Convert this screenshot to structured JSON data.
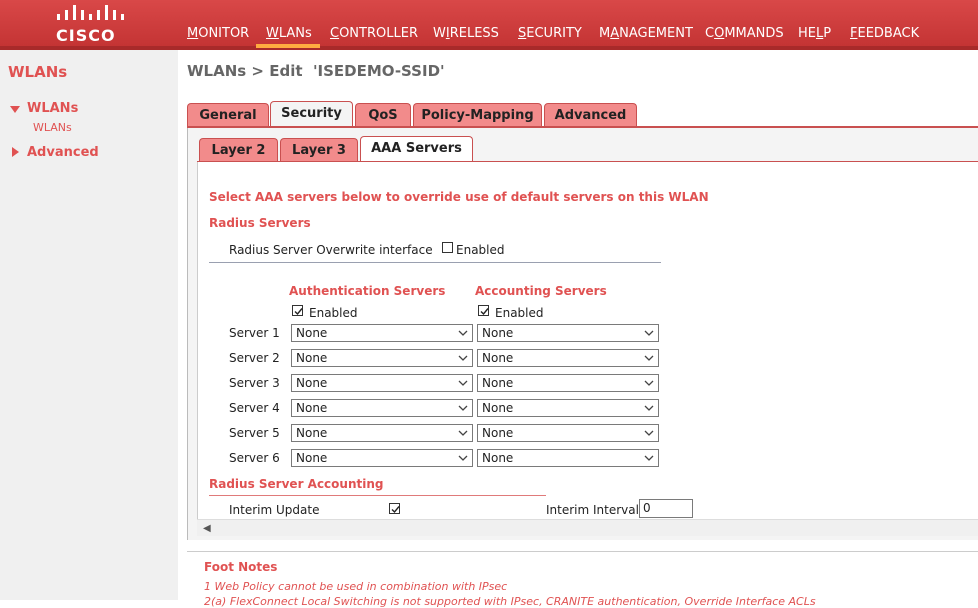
{
  "brand": {
    "name": "CISCO",
    "accent": "#c94040",
    "active_tab_color": "#ffab40"
  },
  "nav": [
    {
      "label": "MONITOR",
      "u": "M",
      "rest": "ONITOR"
    },
    {
      "label": "WLANs",
      "u": "W",
      "rest": "LANs"
    },
    {
      "label": "CONTROLLER",
      "u": "C",
      "rest": "ONTROLLER"
    },
    {
      "label": "WIRELESS",
      "u": "I",
      "pre": "W",
      "rest": "RELESS"
    },
    {
      "label": "SECURITY",
      "u": "S",
      "rest": "ECURITY"
    },
    {
      "label": "MANAGEMENT",
      "u": "A",
      "pre": "M",
      "rest": "NAGEMENT"
    },
    {
      "label": "COMMANDS",
      "u": "O",
      "pre": "C",
      "rest": "MMANDS"
    },
    {
      "label": "HELP",
      "u": "L",
      "pre": "HE",
      "rest": "P"
    },
    {
      "label": "FEEDBACK",
      "u": "F",
      "rest": "EEDBACK"
    }
  ],
  "sidebar": {
    "title": "WLANs",
    "items": [
      {
        "label": "WLANs",
        "expanded": true,
        "children": [
          "WLANs"
        ]
      },
      {
        "label": "Advanced",
        "expanded": false
      }
    ]
  },
  "page": {
    "title": "WLANs > Edit  'ISEDEMO-SSID'"
  },
  "tabs": [
    "General",
    "Security",
    "QoS",
    "Policy-Mapping",
    "Advanced"
  ],
  "active_tab": "Security",
  "subtabs": [
    "Layer 2",
    "Layer 3",
    "AAA Servers"
  ],
  "active_subtab": "AAA Servers",
  "aaa": {
    "intro": "Select AAA servers below to override use of default servers on this WLAN",
    "radius_heading": "Radius Servers",
    "overwrite_label": "Radius Server Overwrite interface",
    "overwrite_enabled_label": "Enabled",
    "overwrite_checked": false,
    "auth_heading": "Authentication Servers",
    "acct_heading": "Accounting Servers",
    "auth_enabled_label": "Enabled",
    "auth_enabled": true,
    "acct_enabled_label": "Enabled",
    "acct_enabled": true,
    "servers": [
      {
        "label": "Server 1",
        "auth": "None",
        "acct": "None"
      },
      {
        "label": "Server 2",
        "auth": "None",
        "acct": "None"
      },
      {
        "label": "Server 3",
        "auth": "None",
        "acct": "None"
      },
      {
        "label": "Server 4",
        "auth": "None",
        "acct": "None"
      },
      {
        "label": "Server 5",
        "auth": "None",
        "acct": "None"
      },
      {
        "label": "Server 6",
        "auth": "None",
        "acct": "None"
      }
    ],
    "accounting_heading": "Radius Server Accounting",
    "interim_update_label": "Interim Update",
    "interim_update": true,
    "interim_interval_label": "Interim Interval",
    "interim_interval_value": "0"
  },
  "footnotes": {
    "title": "Foot Notes",
    "items": [
      "1 Web Policy cannot be used in combination with IPsec",
      "2(a) FlexConnect Local Switching is not supported with IPsec, CRANITE authentication, Override Interface ACLs"
    ]
  }
}
